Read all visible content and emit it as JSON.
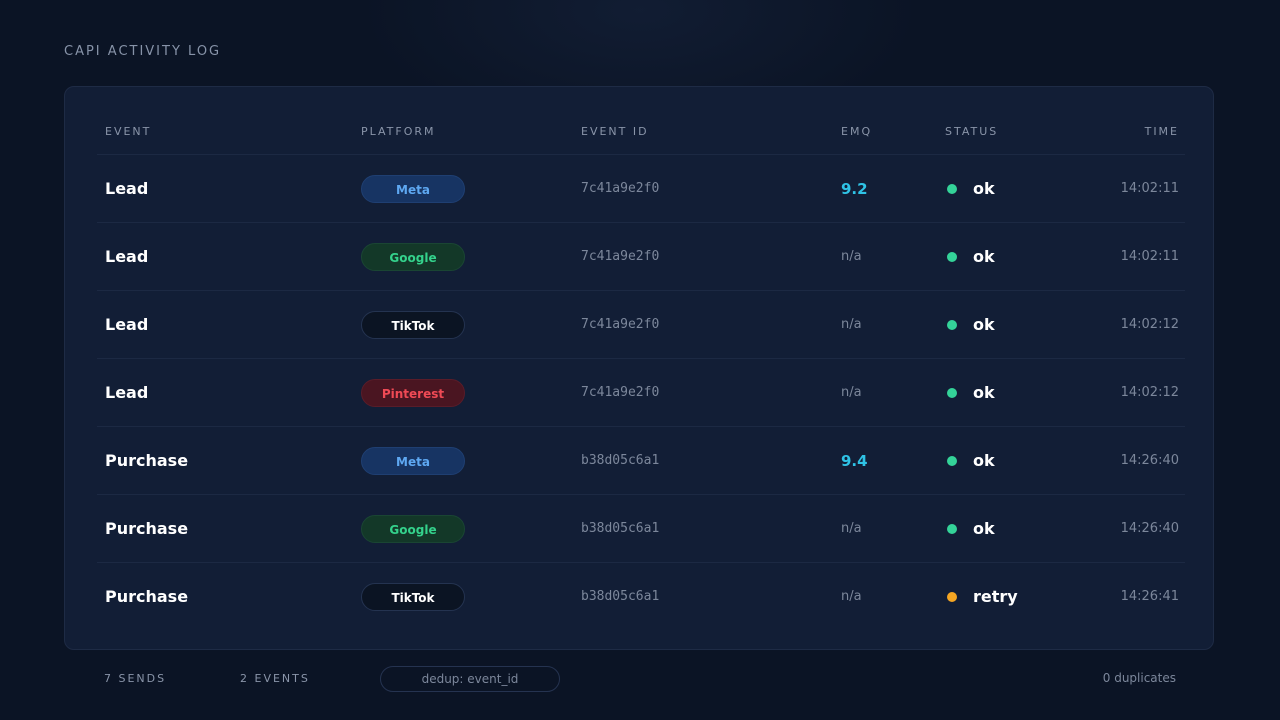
{
  "page": {
    "title": "CAPI ACTIVITY LOG"
  },
  "table": {
    "columns": {
      "event": "EVENT",
      "platform": "PLATFORM",
      "event_id": "EVENT ID",
      "emq": "EMQ",
      "status": "STATUS",
      "time": "TIME"
    },
    "rows": [
      {
        "event": "Lead",
        "platform": "Meta",
        "platform_key": "meta",
        "event_id": "7c41a9e2f0",
        "emq": "9.2",
        "emq_scored": true,
        "status": "ok",
        "status_color": "#34d399",
        "time": "14:02:11"
      },
      {
        "event": "Lead",
        "platform": "Google",
        "platform_key": "google",
        "event_id": "7c41a9e2f0",
        "emq": "n/a",
        "emq_scored": false,
        "status": "ok",
        "status_color": "#34d399",
        "time": "14:02:11"
      },
      {
        "event": "Lead",
        "platform": "TikTok",
        "platform_key": "tiktok",
        "event_id": "7c41a9e2f0",
        "emq": "n/a",
        "emq_scored": false,
        "status": "ok",
        "status_color": "#34d399",
        "time": "14:02:12"
      },
      {
        "event": "Lead",
        "platform": "Pinterest",
        "platform_key": "pinterest",
        "event_id": "7c41a9e2f0",
        "emq": "n/a",
        "emq_scored": false,
        "status": "ok",
        "status_color": "#34d399",
        "time": "14:02:12"
      },
      {
        "event": "Purchase",
        "platform": "Meta",
        "platform_key": "meta",
        "event_id": "b38d05c6a1",
        "emq": "9.4",
        "emq_scored": true,
        "status": "ok",
        "status_color": "#34d399",
        "time": "14:26:40"
      },
      {
        "event": "Purchase",
        "platform": "Google",
        "platform_key": "google",
        "event_id": "b38d05c6a1",
        "emq": "n/a",
        "emq_scored": false,
        "status": "ok",
        "status_color": "#34d399",
        "time": "14:26:40"
      },
      {
        "event": "Purchase",
        "platform": "TikTok",
        "platform_key": "tiktok",
        "event_id": "b38d05c6a1",
        "emq": "n/a",
        "emq_scored": false,
        "status": "retry",
        "status_color": "#f5a623",
        "time": "14:26:41"
      }
    ]
  },
  "footer": {
    "sends": "7 SENDS",
    "events": "2 EVENTS",
    "dedup": "dedup: event_id",
    "duplicates": "0 duplicates"
  }
}
